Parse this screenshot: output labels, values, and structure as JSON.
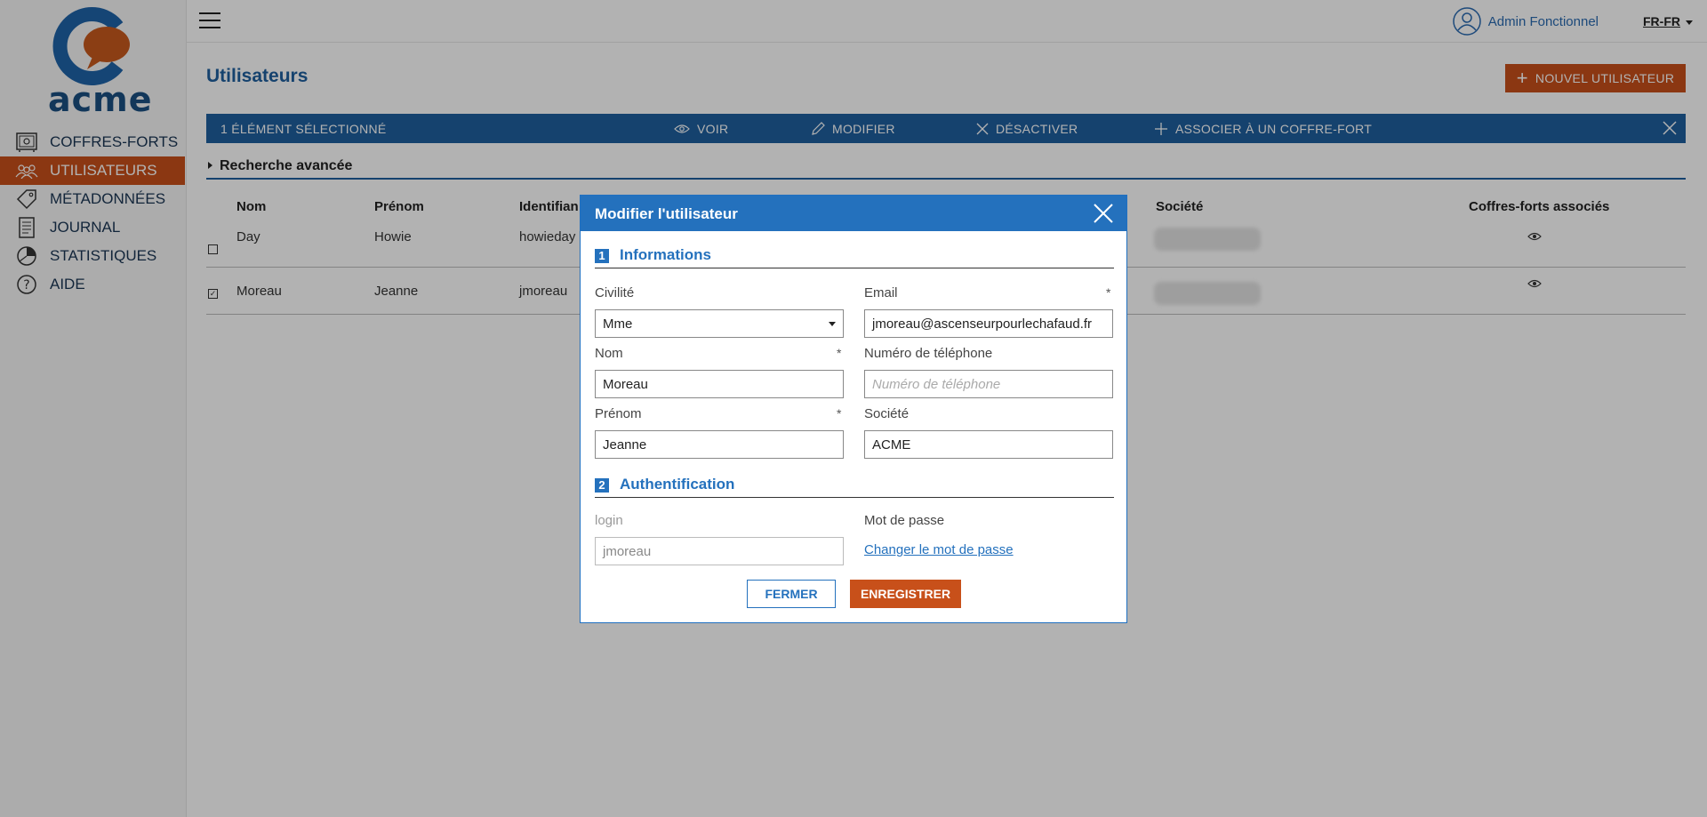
{
  "brand": {
    "logo_text": "acme"
  },
  "sidebar": {
    "items": [
      {
        "label": "COFFRES-FORTS",
        "icon": "safe-icon"
      },
      {
        "label": "UTILISATEURS",
        "icon": "users-icon",
        "active": true
      },
      {
        "label": "MÉTADONNÉES",
        "icon": "tag-icon"
      },
      {
        "label": "JOURNAL",
        "icon": "journal-icon"
      },
      {
        "label": "STATISTIQUES",
        "icon": "pie-chart-icon"
      },
      {
        "label": "AIDE",
        "icon": "help-icon"
      }
    ]
  },
  "topbar": {
    "user_name": "Admin Fonctionnel",
    "language": "FR-FR"
  },
  "page": {
    "title": "Utilisateurs",
    "new_user_label": "NOUVEL UTILISATEUR"
  },
  "selection_bar": {
    "count_label": "1 ÉLÉMENT SÉLECTIONNÉ",
    "actions": [
      {
        "label": "VOIR",
        "icon": "eye-icon"
      },
      {
        "label": "MODIFIER",
        "icon": "pencil-icon"
      },
      {
        "label": "DÉSACTIVER",
        "icon": "close-icon"
      },
      {
        "label": "ASSOCIER À UN COFFRE-FORT",
        "icon": "plus-icon"
      }
    ]
  },
  "advanced_search_label": "Recherche avancée",
  "table": {
    "headers": [
      "Nom",
      "Prénom",
      "Identifian",
      "Société",
      "Coffres-forts associés"
    ],
    "rows": [
      {
        "nom": "Day",
        "prenom": "Howie",
        "identifiant": "howieday",
        "checked": false
      },
      {
        "nom": "Moreau",
        "prenom": "Jeanne",
        "identifiant": "jmoreau",
        "checked": true
      }
    ]
  },
  "modal": {
    "title": "Modifier l'utilisateur",
    "section1": {
      "number": "1",
      "title": "Informations"
    },
    "section2": {
      "number": "2",
      "title": "Authentification"
    },
    "fields": {
      "civilite": {
        "label": "Civilité",
        "value": "Mme"
      },
      "email": {
        "label": "Email",
        "value": "jmoreau@ascenseurpourlechafaud.fr",
        "required": "*"
      },
      "nom": {
        "label": "Nom",
        "value": "Moreau",
        "required": "*"
      },
      "telephone": {
        "label": "Numéro de téléphone",
        "placeholder": "Numéro de téléphone"
      },
      "prenom": {
        "label": "Prénom",
        "value": "Jeanne",
        "required": "*"
      },
      "societe": {
        "label": "Société",
        "value": "ACME"
      },
      "login": {
        "label": "login",
        "value": "jmoreau"
      },
      "password": {
        "label": "Mot de passe",
        "link": "Changer le mot de passe"
      }
    },
    "buttons": {
      "close": "FERMER",
      "save": "ENREGISTRER"
    }
  },
  "colors": {
    "primary": "#2471bd",
    "accent": "#c8501a",
    "nav_text": "#1a3553"
  }
}
